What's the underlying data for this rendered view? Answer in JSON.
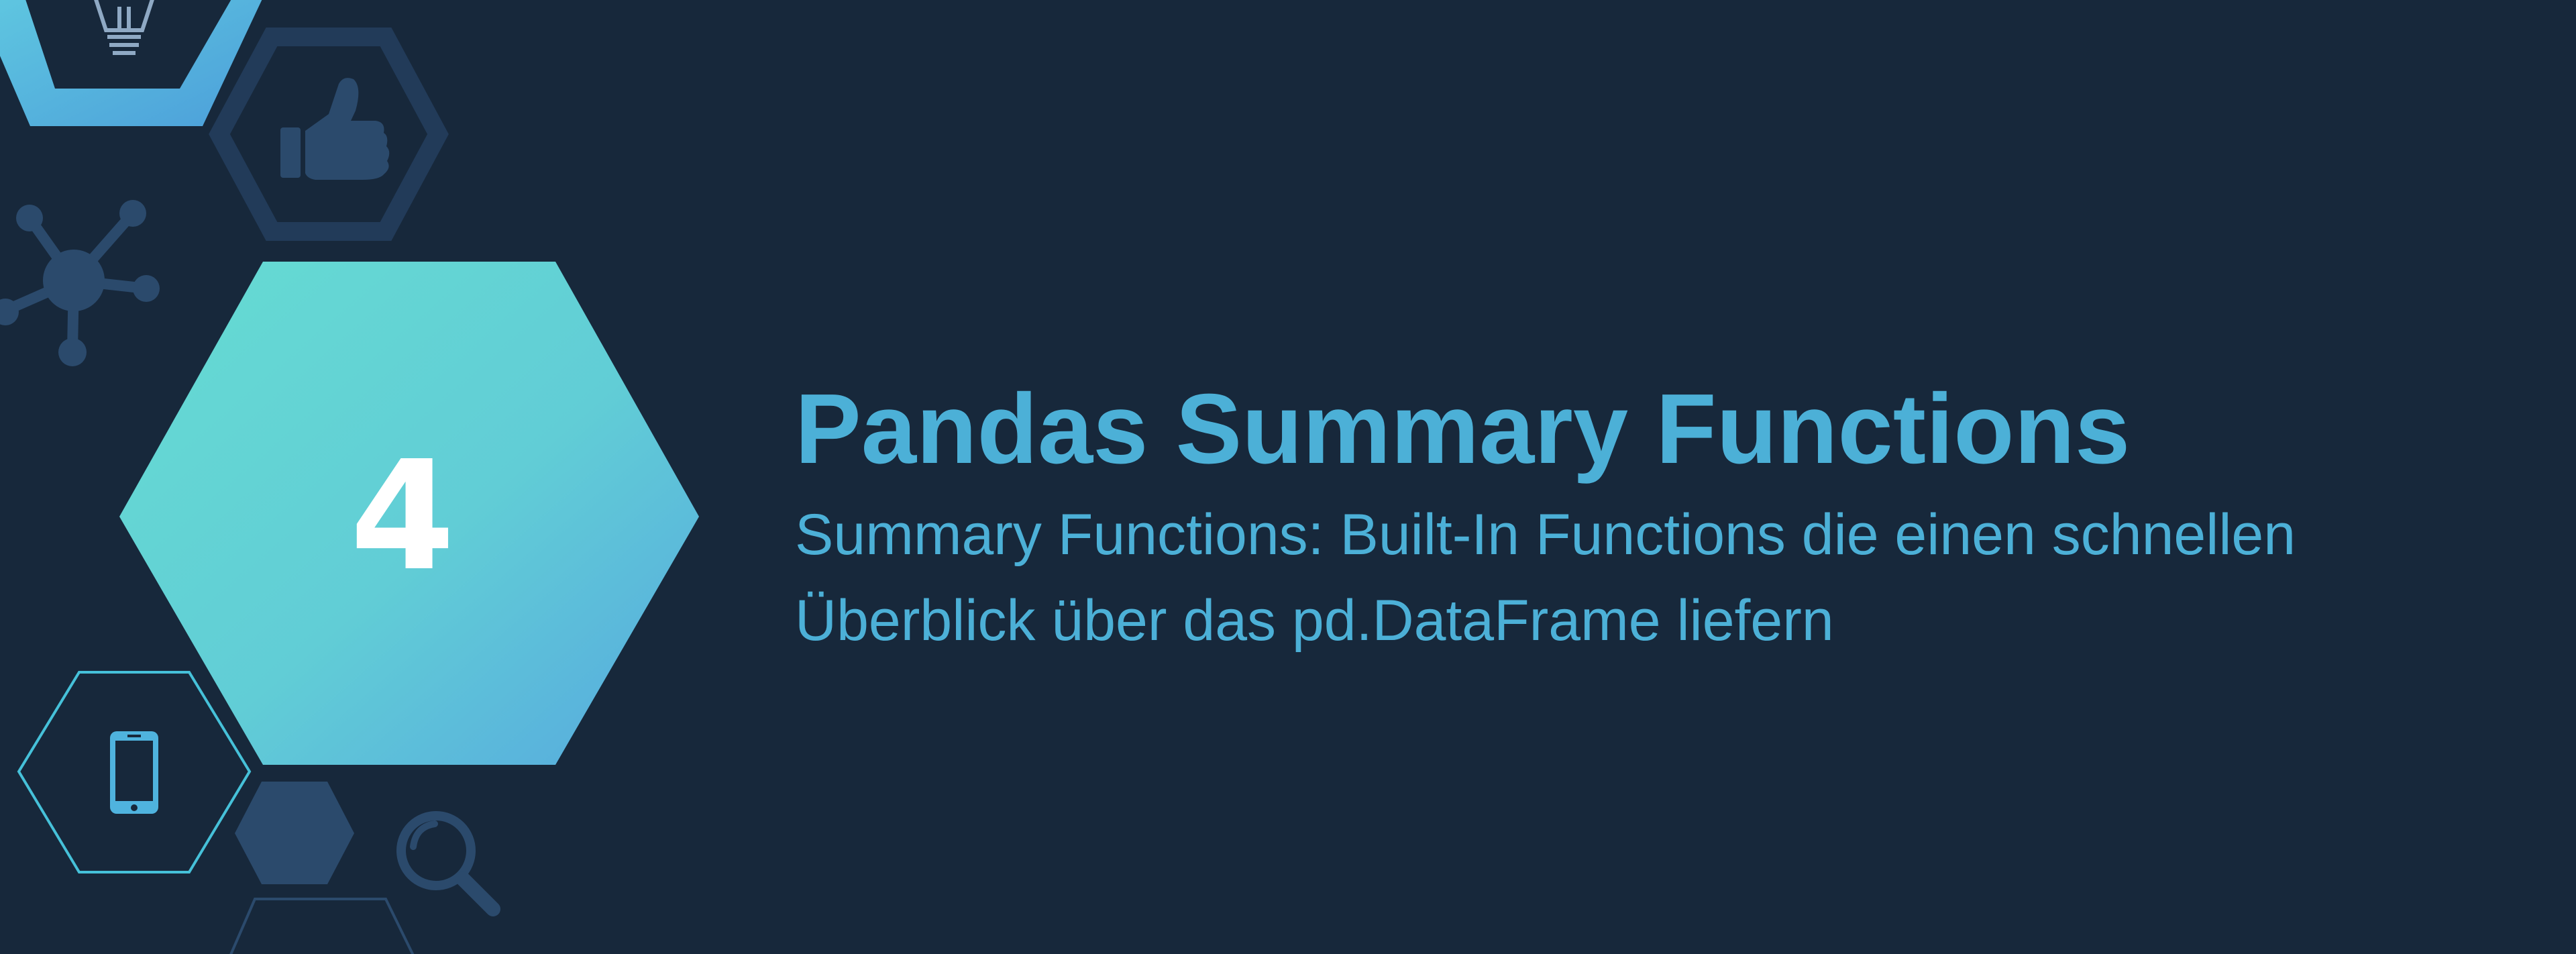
{
  "slide": {
    "number": "4",
    "title": "Pandas Summary Functions",
    "subtitle_lines": [
      "Summary Functions: Built-In Functions die einen schnellen",
      "Überblick über das pd.DataFrame liefern"
    ]
  },
  "decorations": {
    "icons": [
      "lightbulb-icon",
      "thumbs-up-icon",
      "network-icon",
      "smartphone-icon",
      "magnifier-icon"
    ]
  },
  "colors": {
    "background": "#17283b",
    "accent_text": "#4cb0d7",
    "hex_gradient_start": "#66dcd2",
    "hex_gradient_end": "#56a8df",
    "icon_blue": "#2b4a6c",
    "outline_cyan": "#46c1d9"
  }
}
